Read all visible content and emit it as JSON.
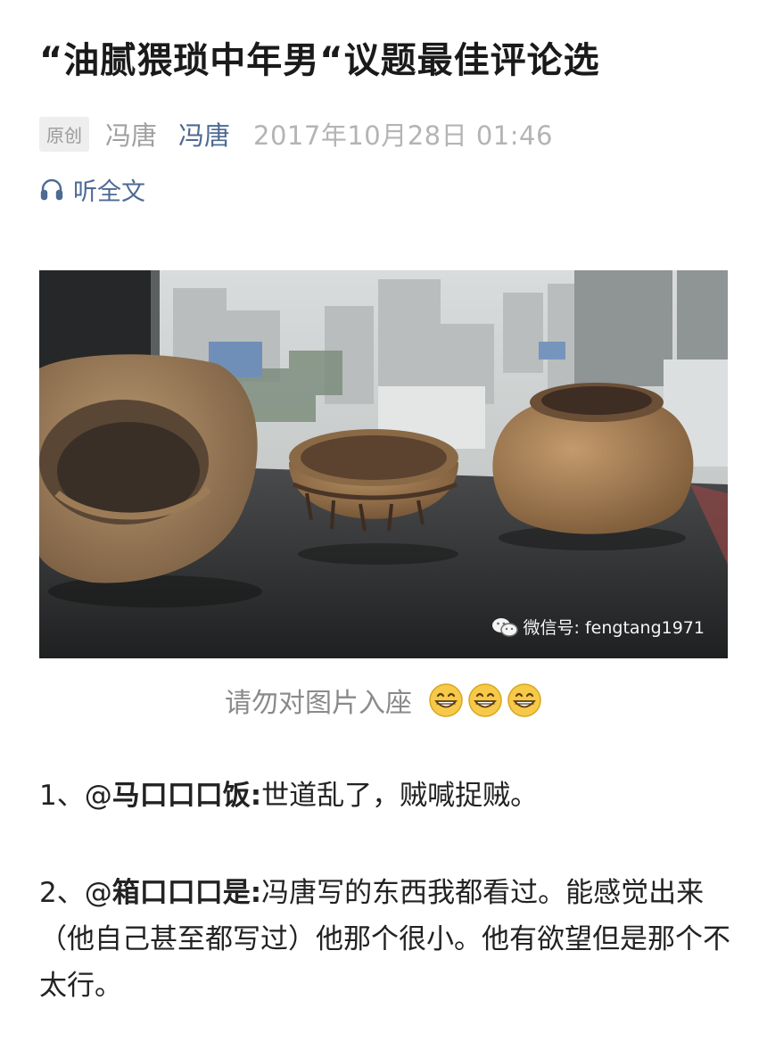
{
  "article": {
    "title": "“油腻猥琐中年男“议题最佳评论选",
    "meta": {
      "badge": "原创",
      "author": "冯唐",
      "account": "冯唐",
      "date": "2017年10月28日 01:46"
    },
    "listen_label": "听全文"
  },
  "image": {
    "watermark": "微信号: fengtang1971",
    "caption": "请勿对图片入座",
    "caption_emojis": [
      "grinning-face-emoji",
      "grinning-face-emoji",
      "grinning-face-emoji"
    ]
  },
  "comments": [
    {
      "prefix": "1、@",
      "user": "马口口口饭:",
      "text": "世道乱了，贼喊捉贼。"
    },
    {
      "prefix": "2、@",
      "user": "箱口口口是:",
      "text": "冯唐写的东西我都看过。能感觉出来（他自己甚至都写过）他那个很小。他有欲望但是那个不太行。"
    }
  ],
  "colors": {
    "link": "#4d6a92",
    "meta_gray": "#a0a0a0",
    "badge_bg": "#eeeeee"
  }
}
